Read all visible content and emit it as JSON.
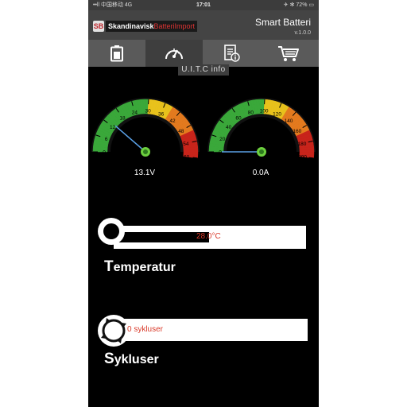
{
  "status_bar": {
    "carrier": "••ll 中国移动  4G",
    "time": "17:01",
    "right": "✈ ✻ 72% ▭"
  },
  "header": {
    "logo_mark": "SB",
    "logo_text_1": "Skandinavisk",
    "logo_text_2": "BatteriImport",
    "title": "Smart Batteri",
    "version": "v.1.0.0"
  },
  "tabs": [
    {
      "name": "battery-icon"
    },
    {
      "name": "speedometer-icon",
      "label": "U.I.T.C info",
      "active": true
    },
    {
      "name": "document-info-icon"
    },
    {
      "name": "cart-icon"
    }
  ],
  "gauges": [
    {
      "name": "voltage-gauge",
      "ticks": [
        "0",
        "6",
        "12",
        "18",
        "24",
        "30",
        "36",
        "42",
        "48",
        "54",
        "60"
      ],
      "max": 60,
      "value": 13.1,
      "reading": "13.1V"
    },
    {
      "name": "current-gauge",
      "ticks": [
        "0",
        "20",
        "40",
        "60",
        "80",
        "100",
        "120",
        "140",
        "160",
        "180",
        "200"
      ],
      "max": 200,
      "value": 0,
      "reading": "0.0A"
    }
  ],
  "temperature": {
    "title_cap": "T",
    "title_rest": "emperatur",
    "value": "28.0°C",
    "fill_fraction": 0.5
  },
  "cycles": {
    "title_cap": "S",
    "title_rest": "ykluser",
    "value": "0 sykluser"
  },
  "colors": {
    "green": "#3aa83a",
    "yellow": "#e8c21c",
    "orange": "#e37a1e",
    "red": "#c8241b",
    "value_red": "#d93a2a"
  }
}
